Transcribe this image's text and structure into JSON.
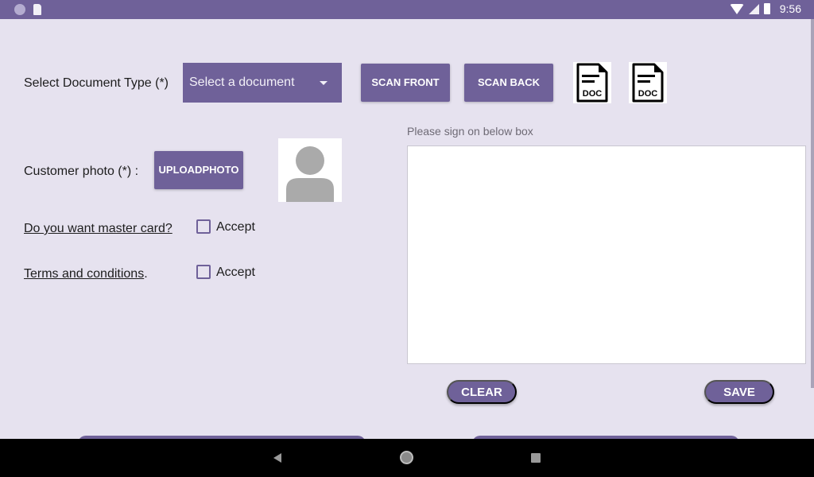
{
  "status_bar": {
    "time": "9:56",
    "left_icons": [
      "notification-dot-icon",
      "sd-card-icon"
    ],
    "right_icons": [
      "wifi-icon",
      "cell-signal-icon",
      "battery-icon"
    ]
  },
  "document_section": {
    "label": "Select Document Type (*)",
    "dropdown": {
      "selected": "Select a document"
    },
    "scan_front_label": "SCAN FRONT",
    "scan_back_label": "SCAN BACK",
    "doc_icon_text": "DOC"
  },
  "photo_section": {
    "label": "Customer photo (*) :",
    "upload_line1": "UPLOAD",
    "upload_line2": "PHOTO"
  },
  "options": [
    {
      "question": "Do you want master card?",
      "checkbox_label": "Accept",
      "checked": false
    },
    {
      "question": "Terms and conditions",
      "suffix": ".",
      "checkbox_label": "Accept",
      "checked": false
    }
  ],
  "signature": {
    "hint": "Please sign on below box",
    "clear_label": "CLEAR",
    "save_label": "SAVE"
  },
  "colors": {
    "primary": "#6f6199",
    "background": "#e6e2ef",
    "nav_bar": "#000000"
  }
}
